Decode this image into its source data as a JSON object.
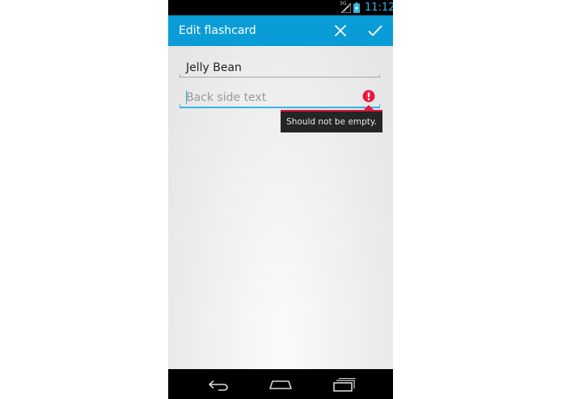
{
  "status_bar": {
    "network_label": "3G",
    "time": "11:12",
    "icons": [
      "signal-icon",
      "battery-charging-icon"
    ]
  },
  "action_bar": {
    "title": "Edit flashcard",
    "actions": [
      {
        "name": "discard",
        "icon": "close-icon"
      },
      {
        "name": "save",
        "icon": "checkmark-icon"
      }
    ]
  },
  "form": {
    "front": {
      "value": "Jelly Bean"
    },
    "back": {
      "value": "",
      "placeholder": "Back side text",
      "error_icon": "error-icon"
    }
  },
  "error_popup": {
    "message": "Should not be empty."
  },
  "nav_bar": {
    "buttons": [
      "back-icon",
      "home-icon",
      "recent-apps-icon"
    ]
  },
  "colors": {
    "action_bar": "#0a9cd6",
    "focus": "#33b5e5",
    "error": "#e8173e",
    "clock": "#33b5e5"
  }
}
